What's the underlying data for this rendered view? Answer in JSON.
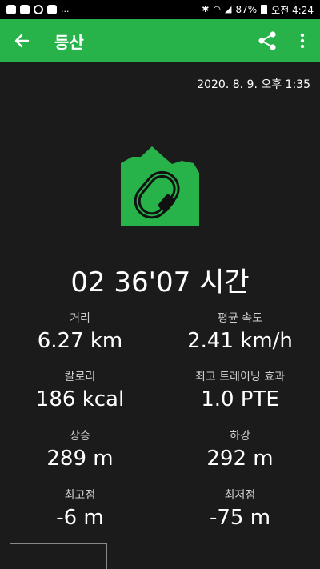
{
  "status_bar": {
    "battery": "87%",
    "time": "오전 4:24",
    "overflow": "..."
  },
  "app_bar": {
    "title": "등산"
  },
  "date": "2020. 8. 9. 오후 1:35",
  "activity_icon": "hiking-carabiner-icon",
  "duration": "02 36'07 시간",
  "stats": [
    {
      "label": "거리",
      "value": "6.27 km"
    },
    {
      "label": "평균 속도",
      "value": "2.41 km/h"
    },
    {
      "label": "칼로리",
      "value": "186 kcal"
    },
    {
      "label": "최고 트레이닝 효과",
      "value": "1.0 PTE"
    },
    {
      "label": "상승",
      "value": "289 m"
    },
    {
      "label": "하강",
      "value": "292 m"
    },
    {
      "label": "최고점",
      "value": "-6 m"
    },
    {
      "label": "최저점",
      "value": "-75 m"
    }
  ],
  "colors": {
    "accent": "#27b24a",
    "background": "#1b1b1b"
  }
}
